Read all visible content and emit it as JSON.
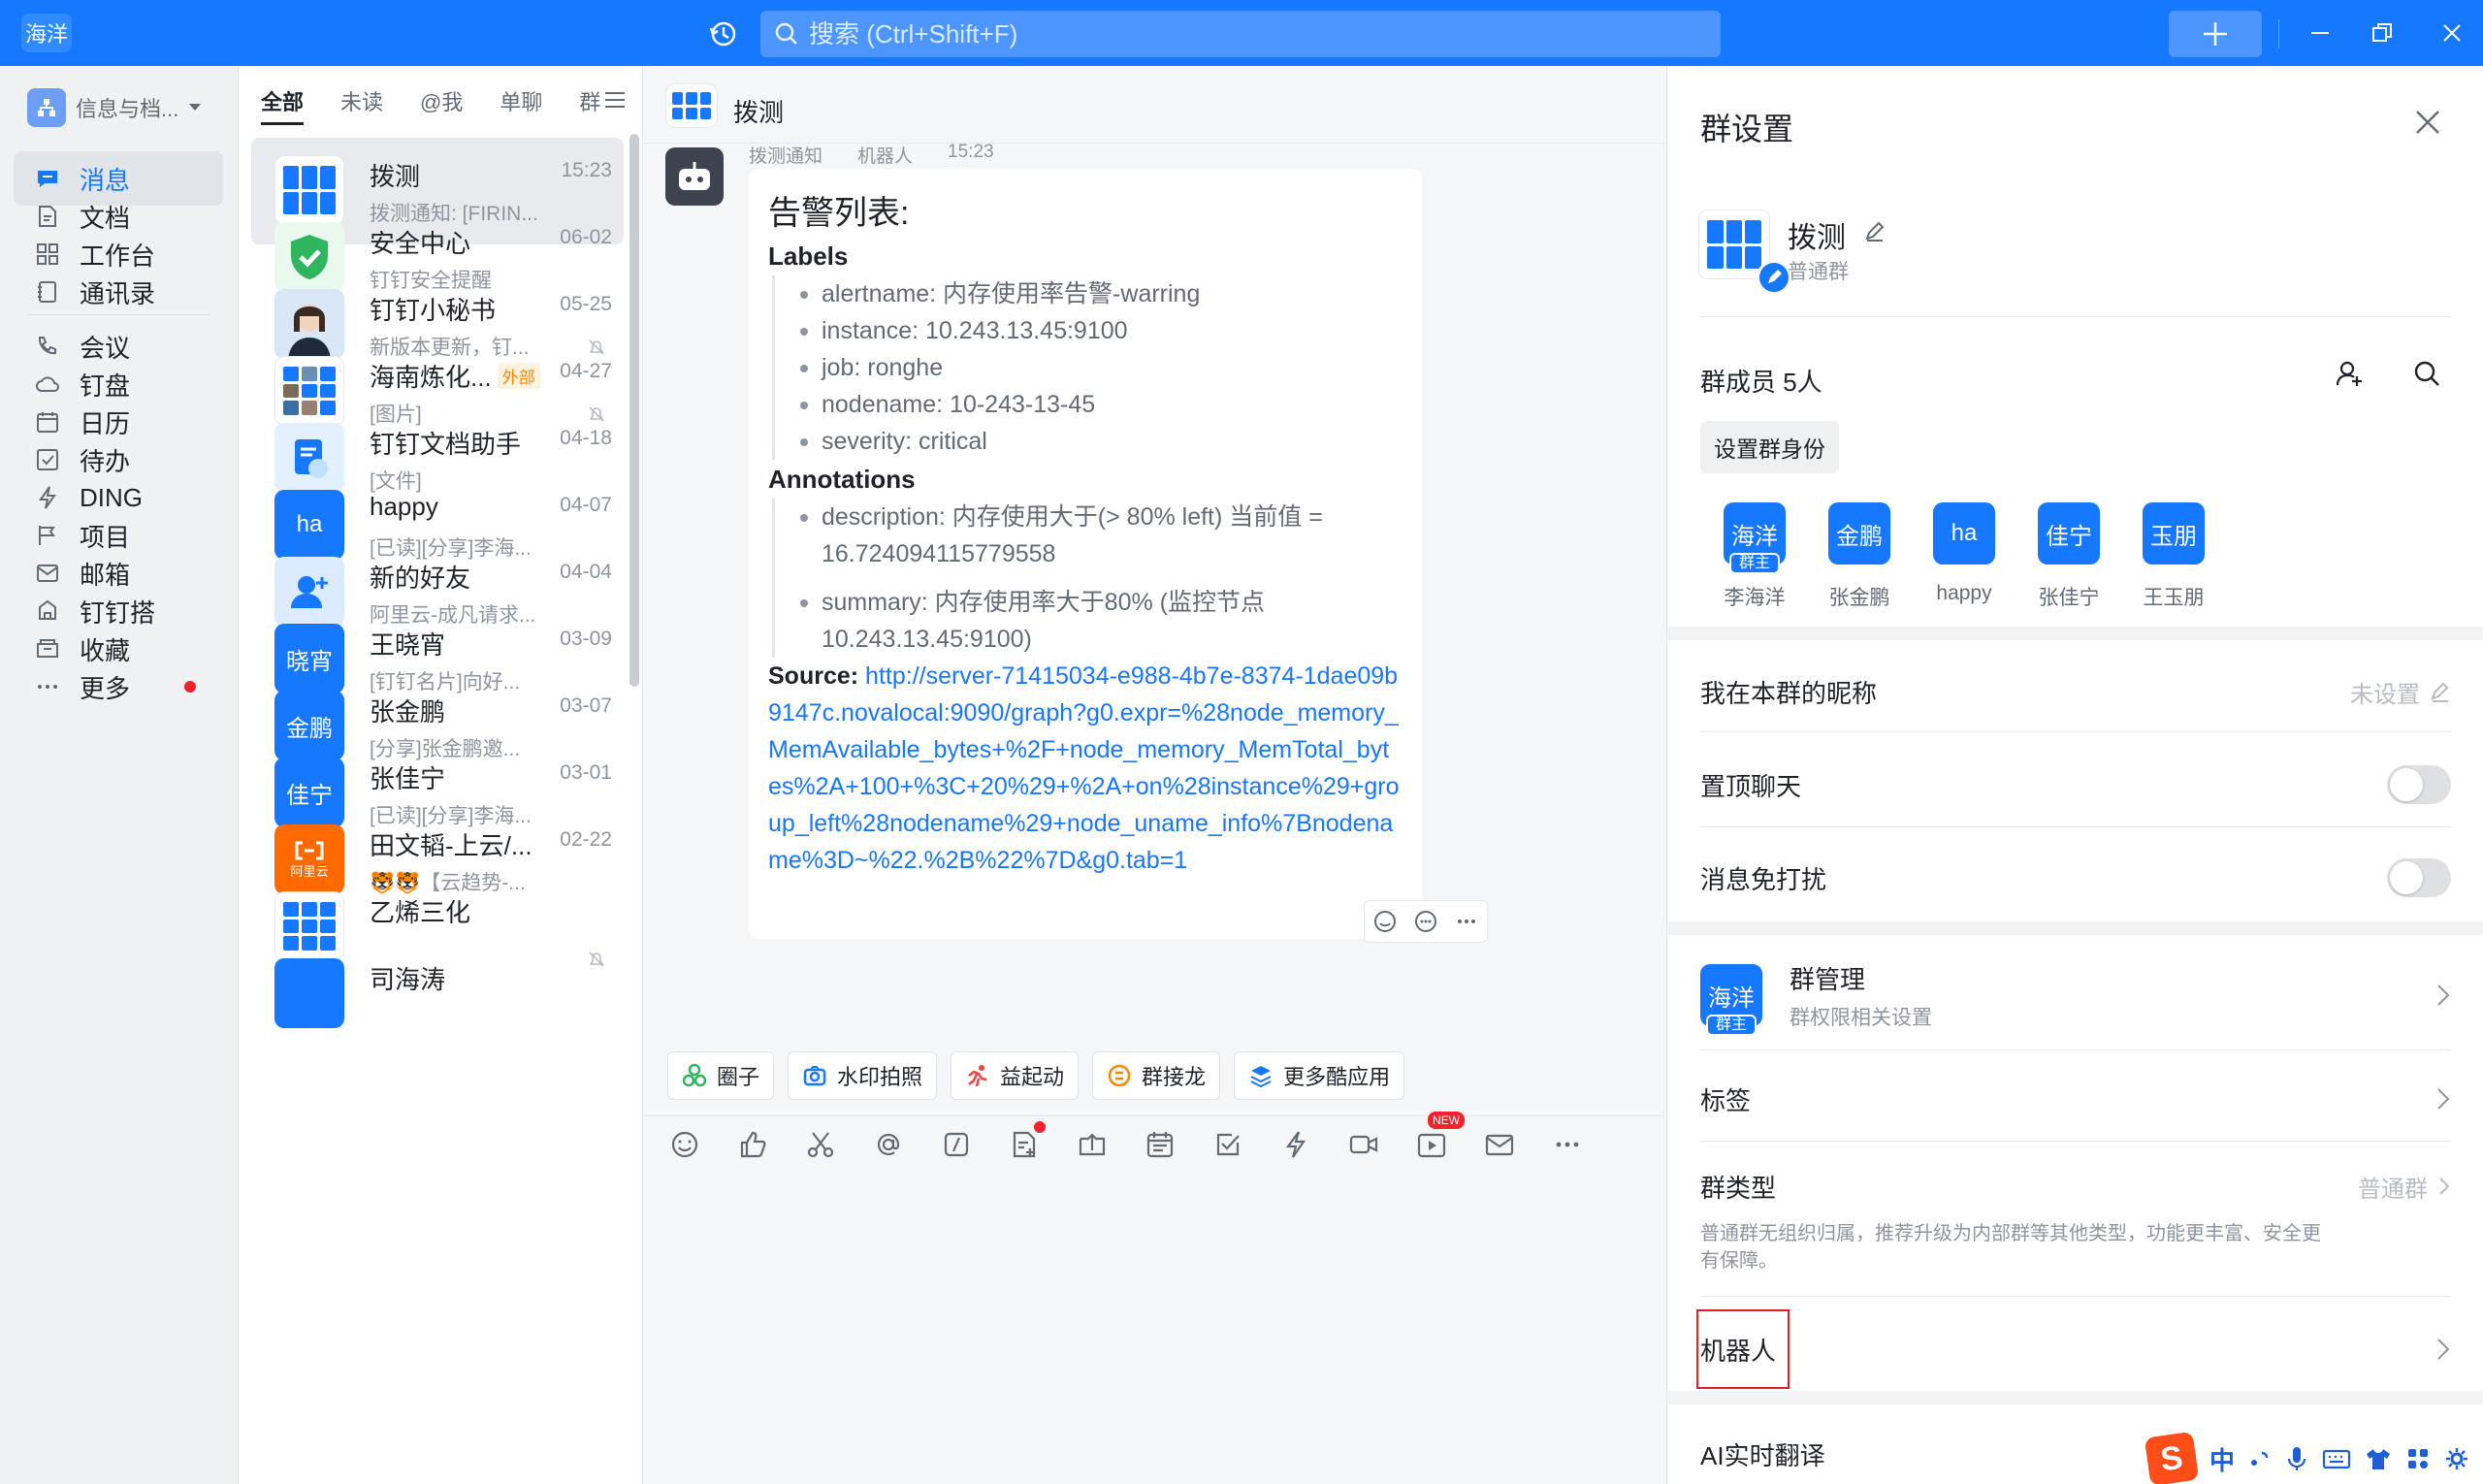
{
  "titlebar": {
    "app_label": "海洋",
    "search_placeholder": "搜索 (Ctrl+Shift+F)",
    "accent": "#1677ff"
  },
  "leftnav": {
    "org_name": "信息与档...",
    "items": [
      {
        "label": "消息",
        "icon": "message-icon"
      },
      {
        "label": "文档",
        "icon": "document-icon"
      },
      {
        "label": "工作台",
        "icon": "workbench-icon"
      },
      {
        "label": "通讯录",
        "icon": "contacts-icon"
      },
      {
        "label": "会议",
        "icon": "meeting-icon"
      },
      {
        "label": "钉盘",
        "icon": "cloud-drive-icon"
      },
      {
        "label": "日历",
        "icon": "calendar-icon"
      },
      {
        "label": "待办",
        "icon": "todo-icon"
      },
      {
        "label": "DING",
        "icon": "ding-icon"
      },
      {
        "label": "项目",
        "icon": "project-icon"
      },
      {
        "label": "邮箱",
        "icon": "mail-icon"
      },
      {
        "label": "钉钉搭",
        "icon": "builder-icon"
      },
      {
        "label": "收藏",
        "icon": "favorites-icon"
      },
      {
        "label": "更多",
        "icon": "more-icon"
      }
    ]
  },
  "convlist": {
    "tabs": [
      "全部",
      "未读",
      "@我",
      "单聊",
      "群"
    ],
    "conversations": [
      {
        "name": "拨测",
        "time": "15:23",
        "preview": "拨测通知: [FIRIN...",
        "avatar_text": ""
      },
      {
        "name": "安全中心",
        "time": "06-02",
        "preview": "钉钉安全提醒",
        "avatar_text": ""
      },
      {
        "name": "钉钉小秘书",
        "time": "05-25",
        "preview": "新版本更新，钉...",
        "avatar_text": ""
      },
      {
        "name": "海南炼化...",
        "tag": "外部",
        "time": "04-27",
        "preview": "[图片]",
        "avatar_text": ""
      },
      {
        "name": "钉钉文档助手",
        "time": "04-18",
        "preview": "[文件]",
        "avatar_text": ""
      },
      {
        "name": "happy",
        "time": "04-07",
        "preview": "[已读][分享]李海...",
        "avatar_text": "ha"
      },
      {
        "name": "新的好友",
        "time": "04-04",
        "preview": "阿里云-成凡请求...",
        "avatar_text": ""
      },
      {
        "name": "王晓宵",
        "time": "03-09",
        "preview": "[钉钉名片]向好...",
        "avatar_text": "晓宵"
      },
      {
        "name": "张金鹏",
        "time": "03-07",
        "preview": "[分享]张金鹏邀...",
        "avatar_text": "金鹏"
      },
      {
        "name": "张佳宁",
        "time": "03-01",
        "preview": "[已读][分享]李海...",
        "avatar_text": "佳宁"
      },
      {
        "name": "田文韬-上云/...",
        "time": "02-22",
        "preview": "🐯🐯【云趋势-...",
        "avatar_text": "阿里云"
      },
      {
        "name": "乙烯三化",
        "time": "",
        "preview": "",
        "avatar_text": ""
      },
      {
        "name": "司海涛",
        "time": "",
        "preview": "",
        "avatar_text": ""
      }
    ]
  },
  "chat": {
    "title": "拨测",
    "message": {
      "sender": "拨测通知",
      "role": "机器人",
      "time": "15:23",
      "heading": "告警列表:",
      "labels_title": "Labels",
      "labels": [
        "alertname: 内存使用率告警-warring",
        "instance: 10.243.13.45:9100",
        "job: ronghe",
        "nodename: 10-243-13-45",
        "severity: critical"
      ],
      "annotations_title": "Annotations",
      "annotations": [
        "description: 内存使用大于(> 80% left) 当前值 = 16.724094115779558",
        "summary: 内存使用率大于80% (监控节点 10.243.13.45:9100)"
      ],
      "source_label": "Source:",
      "source_url": "http://server-71415034-e988-4b7e-8374-1dae09b9147c.novalocal:9090/graph?g0.expr=%28node_memory_MemAvailable_bytes+%2F+node_memory_MemTotal_bytes%2A+100+%3C+20%29+%2A+on%28instance%29+group_left%28nodename%29+node_uname_info%7Bnodename%3D~%22.%2B%22%7D&g0.tab=1"
    },
    "quick_apps": [
      "圈子",
      "水印拍照",
      "益起动",
      "群接龙",
      "更多酷应用"
    ],
    "toolbar_new_tag": "NEW"
  },
  "panel": {
    "title": "群设置",
    "group_name": "拨测",
    "group_type": "普通群",
    "members_title": "群成员 5人",
    "set_identity": "设置群身份",
    "owner_tag": "群主",
    "members": [
      {
        "avatar": "海洋",
        "name": "李海洋",
        "owner": true
      },
      {
        "avatar": "金鹏",
        "name": "张金鹏",
        "owner": false
      },
      {
        "avatar": "ha",
        "name": "happy",
        "owner": false
      },
      {
        "avatar": "佳宁",
        "name": "张佳宁",
        "owner": false
      },
      {
        "avatar": "玉朋",
        "name": "王玉朋",
        "owner": false
      }
    ],
    "nickname_label": "我在本群的昵称",
    "nickname_value": "未设置",
    "pin_label": "置顶聊天",
    "mute_label": "消息免打扰",
    "admin_avatar": "海洋",
    "admin_label": "群管理",
    "admin_sub": "群权限相关设置",
    "tags_label": "标签",
    "group_type_label": "群类型",
    "group_type_value": "普通群",
    "group_type_desc": "普通群无组织归属，推荐升级为内部群等其他类型，功能更丰富、安全更有保障。",
    "robot_label": "机器人",
    "ai_translate_label": "AI实时翻译"
  },
  "ime": {
    "logo": "S",
    "mode": "中"
  }
}
